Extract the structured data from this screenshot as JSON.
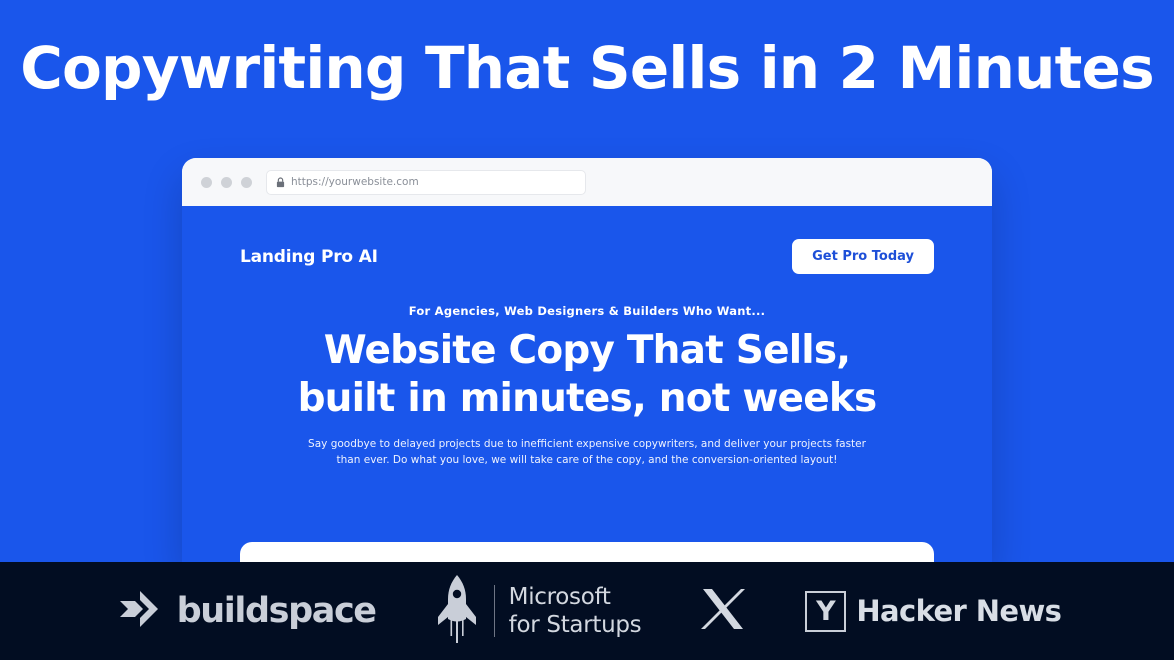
{
  "hero": {
    "title": "Copywriting That Sells in 2 Minutes"
  },
  "browser": {
    "url": "https://yourwebsite.com",
    "lock_icon": "lock-icon",
    "traffic_lights": [
      "dot-red",
      "dot-yellow",
      "dot-green"
    ]
  },
  "site": {
    "brand": "Landing Pro AI",
    "cta_label": "Get Pro Today",
    "eyebrow": "For Agencies, Web Designers & Builders Who Want...",
    "headline_line1": "Website Copy That Sells,",
    "headline_line2": "built in minutes, not weeks",
    "subcopy": "Say goodbye to delayed projects due to inefficient expensive copywriters, and deliver your projects faster than ever. Do what you love, we will take care of the copy, and the conversion-oriented layout!"
  },
  "logo_bar": {
    "buildspace": {
      "name": "buildspace",
      "icon": "buildspace-arrow-icon"
    },
    "microsoft_for_startups": {
      "icon": "rocket-icon",
      "line1": "Microsoft",
      "line2": "for Startups"
    },
    "x": {
      "icon": "x-logo-icon"
    },
    "hacker_news": {
      "badge": "Y",
      "name": "Hacker News"
    }
  },
  "colors": {
    "brand_blue": "#1a56eb",
    "footer_navy": "#020d22",
    "cta_text": "#1d4fd8",
    "logo_gray": "#c9ced8",
    "white": "#ffffff"
  }
}
